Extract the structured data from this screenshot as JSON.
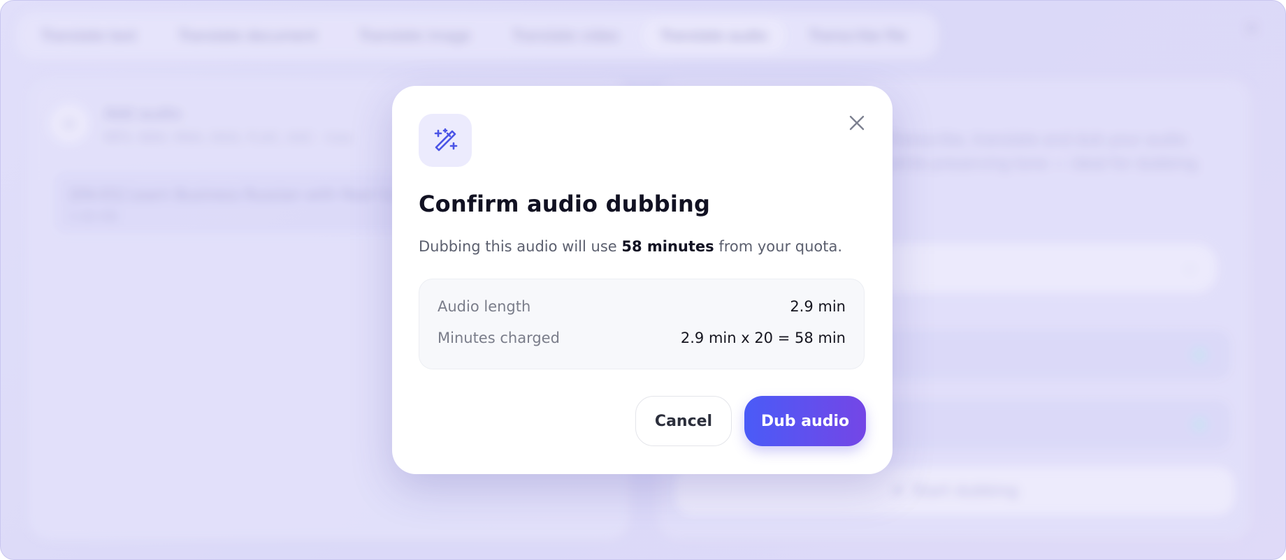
{
  "background": {
    "tabs": [
      {
        "label": "Translate text",
        "active": false
      },
      {
        "label": "Translate document",
        "active": false
      },
      {
        "label": "Translate image",
        "active": false
      },
      {
        "label": "Translate video",
        "active": false
      },
      {
        "label": "Translate audio",
        "active": true
      },
      {
        "label": "Transcribe file",
        "active": false
      }
    ],
    "add_audio": {
      "title": "Add audio",
      "subtitle": "MP3, WAV, M4A, OGG, FLAC, AAC · max"
    },
    "file": {
      "name": "[EN-ES] Learn Business Russian with Real Conv...",
      "size": "5.98 MB"
    },
    "description": "Transcribe, translate and dub your audio while preserving tone — ideal for dubbing.",
    "start_label": "Start dubbing",
    "icons": {
      "add": "plus-icon",
      "close": "close-icon",
      "chevron": "chevron-down-icon",
      "start": "sparkle-icon"
    }
  },
  "dialog": {
    "icon": "magic-wand-icon",
    "title": "Confirm audio dubbing",
    "message_prefix": "Dubbing this audio will use ",
    "message_highlight": "58 minutes",
    "message_suffix": " from your quota.",
    "rows": [
      {
        "label": "Audio length",
        "value": "2.9 min"
      },
      {
        "label": "Minutes charged",
        "value": "2.9 min x 20 = 58 min"
      }
    ],
    "cancel_label": "Cancel",
    "confirm_label": "Dub audio",
    "accent_colors": [
      "#4a5bf7",
      "#7446e6"
    ]
  }
}
